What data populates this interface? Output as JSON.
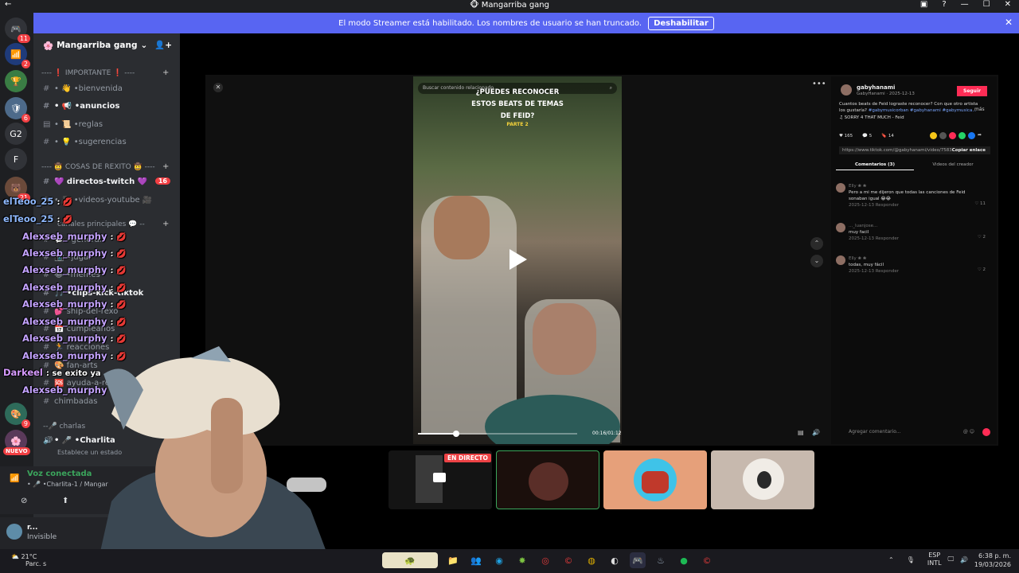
{
  "window": {
    "title": "Mangarriba gang"
  },
  "banner": {
    "text": "El modo Streamer está habilitado. Los nombres de usuario se han truncado.",
    "button": "Deshabilitar"
  },
  "servers": [
    {
      "label": "",
      "badge": "11"
    },
    {
      "label": "",
      "badge": "2"
    },
    {
      "label": "",
      "badge": ""
    },
    {
      "label": "",
      "badge": "6"
    },
    {
      "label": "G2",
      "badge": ""
    },
    {
      "label": "F",
      "badge": ""
    },
    {
      "label": "",
      "badge": "21"
    },
    {
      "label": "",
      "badge": "9"
    },
    {
      "label": "NUEVO",
      "badge": ""
    }
  ],
  "guild": {
    "name": "Mangarriba gang"
  },
  "categories": {
    "important": "---- ❗ IMPORTANTE ❗ ----",
    "rexito": "---- 🤠 COSAS DE REXITO 🤠 ----",
    "principales": "canales principales 💬 --",
    "charlas": "--🎤 charlas"
  },
  "channels": [
    {
      "label": "• 👋 •bienvenida"
    },
    {
      "label": "• 📢 •anuncios"
    },
    {
      "label": "• 📜 •reglas"
    },
    {
      "label": "• 💡 •sugerencias"
    },
    {
      "label": "💜 directos-twitch 💜",
      "badge": "16"
    },
    {
      "label": "• 🎥 •videos-youtube 🎥"
    },
    {
      "label": "💬 •general"
    },
    {
      "label": "📷 •jugar"
    },
    {
      "label": "😂 •memes"
    },
    {
      "label": "🎵 •clips-kick-tiktok"
    },
    {
      "label": "💕 ship-del-rexo"
    },
    {
      "label": "📅 cumpleaños"
    },
    {
      "label": "🏃 reacciones"
    },
    {
      "label": "🎨 fan-arts"
    },
    {
      "label": "🆘 ayuda-a-rexco"
    },
    {
      "label": "chimbadas"
    }
  ],
  "voice": {
    "channel_user": "• 🎤 •Charlita",
    "hint": "Establece un estado",
    "status": "Voz conectada",
    "location": "• 🎤 •Charlita-1 / Mangar"
  },
  "user": {
    "name": "r...",
    "status": "Invisible"
  },
  "chat": [
    {
      "user": "elTeoo_25",
      "msg": ": 💋"
    },
    {
      "user": "elTeoo_25",
      "msg": ": 💋"
    },
    {
      "user": "Alexseb_murphy",
      "msg": ": 💋"
    },
    {
      "user": "Alexseb_murphy",
      "msg": ": 💋"
    },
    {
      "user": "Alexseb_murphy",
      "msg": ": 💋"
    },
    {
      "user": "Alexseb_murphy",
      "msg": ": 💋"
    },
    {
      "user": "Alexseb_murphy",
      "msg": ": 💋"
    },
    {
      "user": "Alexseb_murphy",
      "msg": ": 💋"
    },
    {
      "user": "Alexseb_murphy",
      "msg": ": 💋"
    },
    {
      "user": "Alexseb_murphy",
      "msg": ": 💋"
    },
    {
      "user": "Darkeel",
      "msg": ": se exito ya"
    },
    {
      "user": "Alexseb_murphy",
      "msg": ": 💋"
    }
  ],
  "video": {
    "search_placeholder": "Buscar contenido relacionado",
    "title_lines": [
      "¿PUEDES RECONOCER",
      "ESTOS BEATS DE TEMAS",
      "DE FEID?"
    ],
    "part": "PARTE 2",
    "time": "00:16/01:12",
    "progress": 0.24
  },
  "tiktok": {
    "author": "gabyhanami",
    "handle": "GabyHanami · 2025-12-13",
    "follow": "Seguir",
    "description": "Cuantos beats de Feid lograste reconocer? Con que otro artista los gustaría?",
    "tags": "#gabymusicorban #gabyhanami #gabymusica...",
    "more": "más",
    "song": "♫ SORRY 4 THAT MUCH - Feid",
    "stats": [
      "♥ 165",
      "💬 5",
      "🔖 14"
    ],
    "link": "https://www.tiktok.com/@gabyhanami/video/7583...",
    "copy": "Copiar enlace",
    "tab_comments": "Comentarios (3)",
    "tab_videos": "Videos del creador",
    "comments": [
      {
        "user": "Elly ❀ ❀",
        "text": "Pero a mi me dijeron que todas las canciones de Feid sonaban igual 😂😂",
        "meta": "2025-12-13    Responder",
        "likes": "11"
      },
      {
        "user": "..._luanjose...",
        "text": "muy facil",
        "meta": "2025-12-13    Responder",
        "likes": "2"
      },
      {
        "user": "Elly ❀ ❀",
        "text": "todas, muy fácil",
        "meta": "2025-12-13    Responder",
        "likes": "2"
      }
    ],
    "compose_placeholder": "Agregar comentario..."
  },
  "thumbs": {
    "live": "EN DIRECTO"
  },
  "taskbar": {
    "temp": "21°C",
    "weather": "Parc. s",
    "lang1": "ESP",
    "lang2": "INTL",
    "time": "6:38 p. m.",
    "date": "19/03/2026"
  }
}
